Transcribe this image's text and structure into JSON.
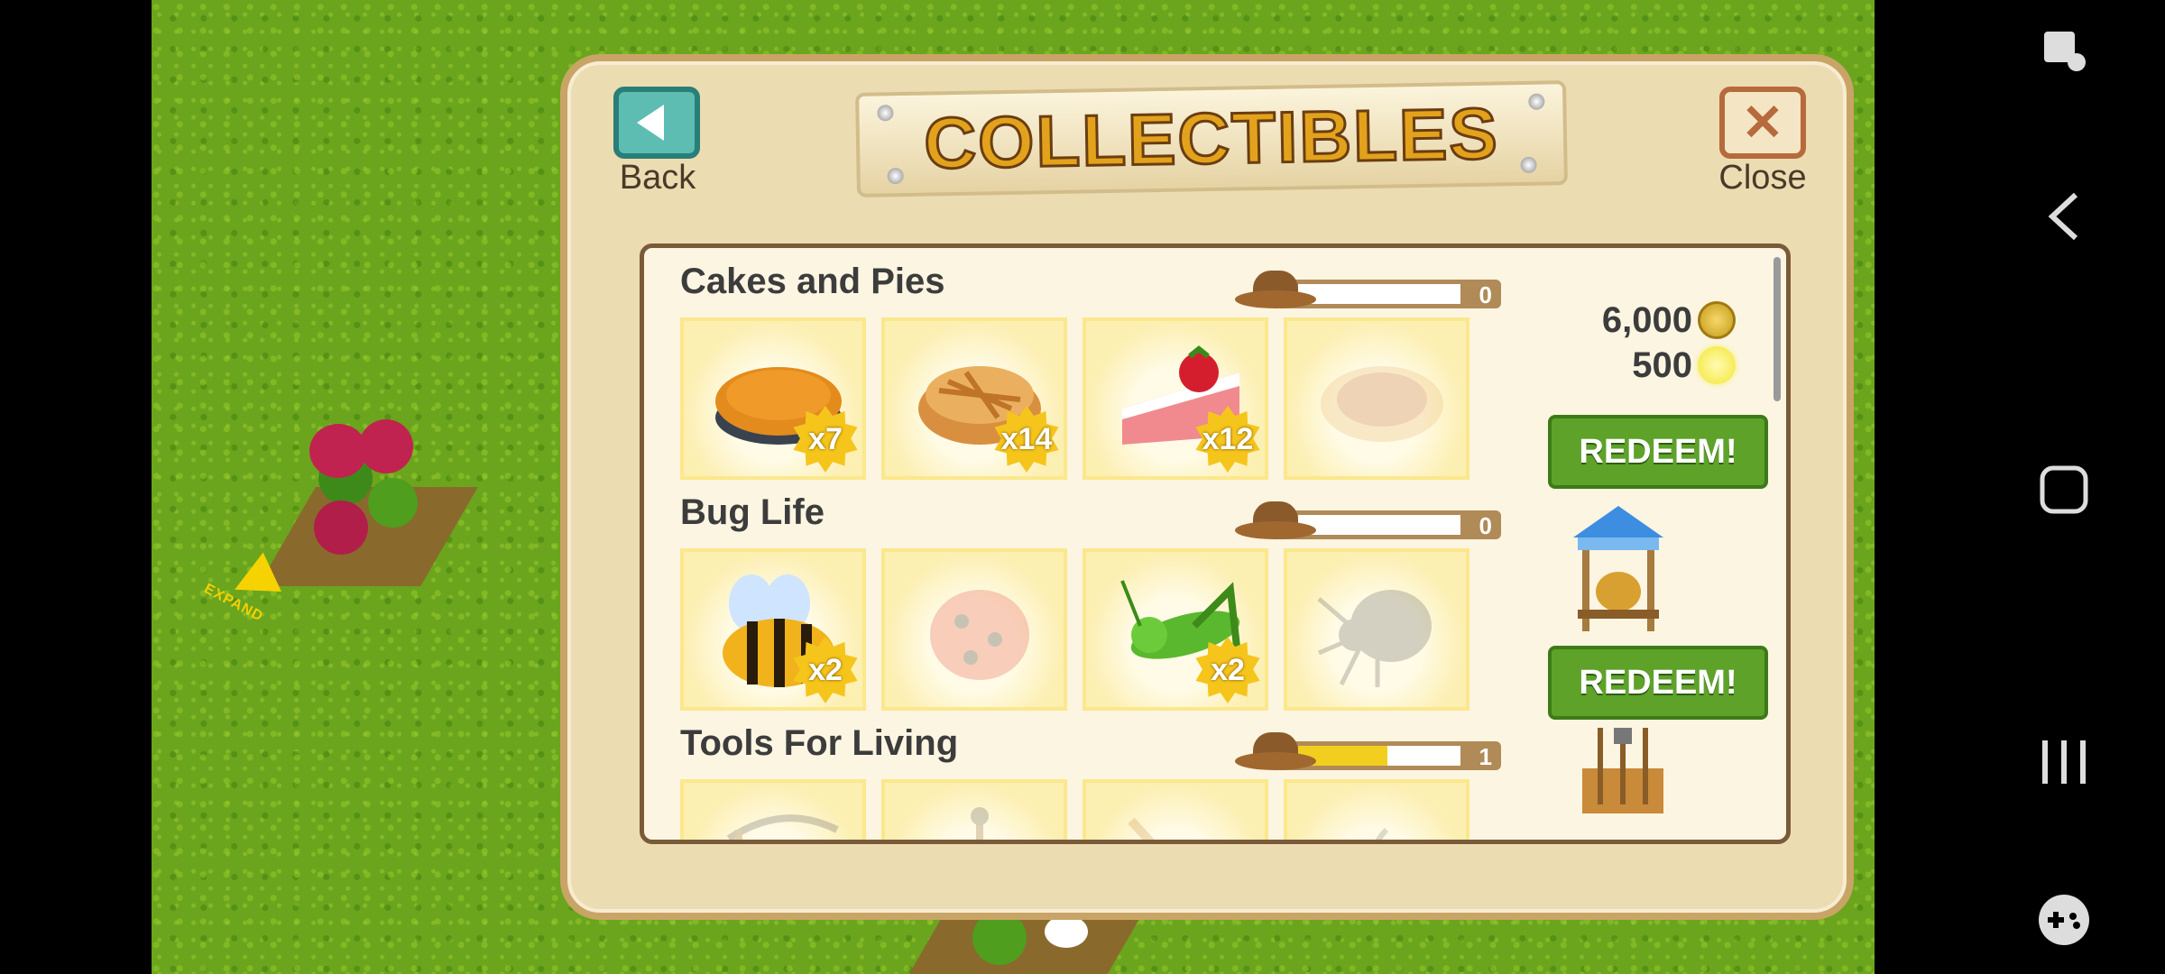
{
  "dialog": {
    "title": "COLLECTIBLES",
    "back_label": "Back",
    "close_label": "Close"
  },
  "sections": [
    {
      "title": "Cakes and Pies",
      "progress_count": "0",
      "progress_fraction": 0,
      "items": [
        {
          "name": "pumpkin-pie",
          "count": "x7",
          "collected": true
        },
        {
          "name": "apple-pie",
          "count": "x14",
          "collected": true
        },
        {
          "name": "strawberry-cake",
          "count": "x12",
          "collected": true
        },
        {
          "name": "fruit-tart",
          "count": "",
          "collected": false
        }
      ],
      "reward": {
        "coins": "6,000",
        "stars": "500"
      },
      "redeem_label": "REDEEM!"
    },
    {
      "title": "Bug Life",
      "progress_count": "0",
      "progress_fraction": 0,
      "items": [
        {
          "name": "bee",
          "count": "x2",
          "collected": true
        },
        {
          "name": "ladybug",
          "count": "",
          "collected": false
        },
        {
          "name": "grasshopper",
          "count": "x2",
          "collected": true
        },
        {
          "name": "spider",
          "count": "",
          "collected": false
        }
      ],
      "reward": {
        "item": "beehive-stand-icon"
      },
      "redeem_label": "REDEEM!"
    },
    {
      "title": "Tools For Living",
      "progress_count": "1",
      "progress_fraction": 0.55,
      "items": [
        {
          "name": "scythe",
          "count": "",
          "collected": false
        },
        {
          "name": "shovel",
          "count": "",
          "collected": false
        },
        {
          "name": "rake",
          "count": "",
          "collected": false
        },
        {
          "name": "hoe",
          "count": "",
          "collected": false
        }
      ],
      "reward": {
        "item": "tool-rack-icon"
      }
    }
  ],
  "farm": {
    "expand_label": "EXPAND"
  },
  "colors": {
    "redeem_green": "#5ea22a",
    "dialog_bg": "#ecdcb2",
    "title_gold": "#e3a21c",
    "badge_yellow": "#f6c51c"
  }
}
